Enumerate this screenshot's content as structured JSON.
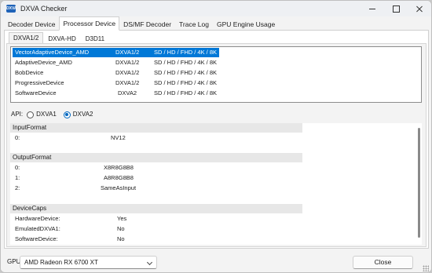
{
  "window": {
    "icon_text": "DXVA",
    "title": "DXVA Checker"
  },
  "top_tabs": [
    {
      "label": "Decoder Device",
      "active": false
    },
    {
      "label": "Processor Device",
      "active": true
    },
    {
      "label": "DS/MF Decoder",
      "active": false
    },
    {
      "label": "Trace Log",
      "active": false
    },
    {
      "label": "GPU Engine Usage",
      "active": false
    }
  ],
  "sub_tabs": [
    {
      "label": "DXVA1/2",
      "active": true
    },
    {
      "label": "DXVA-HD",
      "active": false
    },
    {
      "label": "D3D11",
      "active": false
    }
  ],
  "devices": [
    {
      "name": "VectorAdaptiveDevice_AMD",
      "api": "DXVA1/2",
      "formats": "SD / HD / FHD / 4K / 8K",
      "selected": true
    },
    {
      "name": "AdaptiveDevice_AMD",
      "api": "DXVA1/2",
      "formats": "SD / HD / FHD / 4K / 8K",
      "selected": false
    },
    {
      "name": "BobDevice",
      "api": "DXVA1/2",
      "formats": "SD / HD / FHD / 4K / 8K",
      "selected": false
    },
    {
      "name": "ProgressiveDevice",
      "api": "DXVA1/2",
      "formats": "SD / HD / FHD / 4K / 8K",
      "selected": false
    },
    {
      "name": "SoftwareDevice",
      "api": "DXVA2",
      "formats": "SD / HD / FHD / 4K / 8K",
      "selected": false
    }
  ],
  "api": {
    "label": "API:",
    "options": [
      {
        "label": "DXVA1",
        "selected": false
      },
      {
        "label": "DXVA2",
        "selected": true
      }
    ]
  },
  "properties": {
    "input_format": {
      "title": "InputFormat",
      "rows": [
        {
          "key": "0:",
          "value": "NV12"
        }
      ]
    },
    "output_format": {
      "title": "OutputFormat",
      "rows": [
        {
          "key": "0:",
          "value": "X8R8G8B8"
        },
        {
          "key": "1:",
          "value": "A8R8G8B8"
        },
        {
          "key": "2:",
          "value": "SameAsInput"
        }
      ]
    },
    "device_caps": {
      "title": "DeviceCaps",
      "rows": [
        {
          "key": "HardwareDevice:",
          "value": "Yes"
        },
        {
          "key": "EmulatedDXVA1:",
          "value": "No"
        },
        {
          "key": "SoftwareDevice:",
          "value": "No"
        }
      ]
    }
  },
  "footer": {
    "gpu_label": "GPU:",
    "gpu_value": "AMD Radeon RX 6700 XT",
    "close_label": "Close"
  },
  "colors": {
    "selection": "#0078d7",
    "radio_accent": "#0067c0"
  },
  "icons": {
    "window_minimize": "minimize-icon",
    "window_maximize": "maximize-icon",
    "window_close": "close-icon",
    "dropdown": "chevron-down-icon",
    "resize": "resize-grip-icon"
  }
}
